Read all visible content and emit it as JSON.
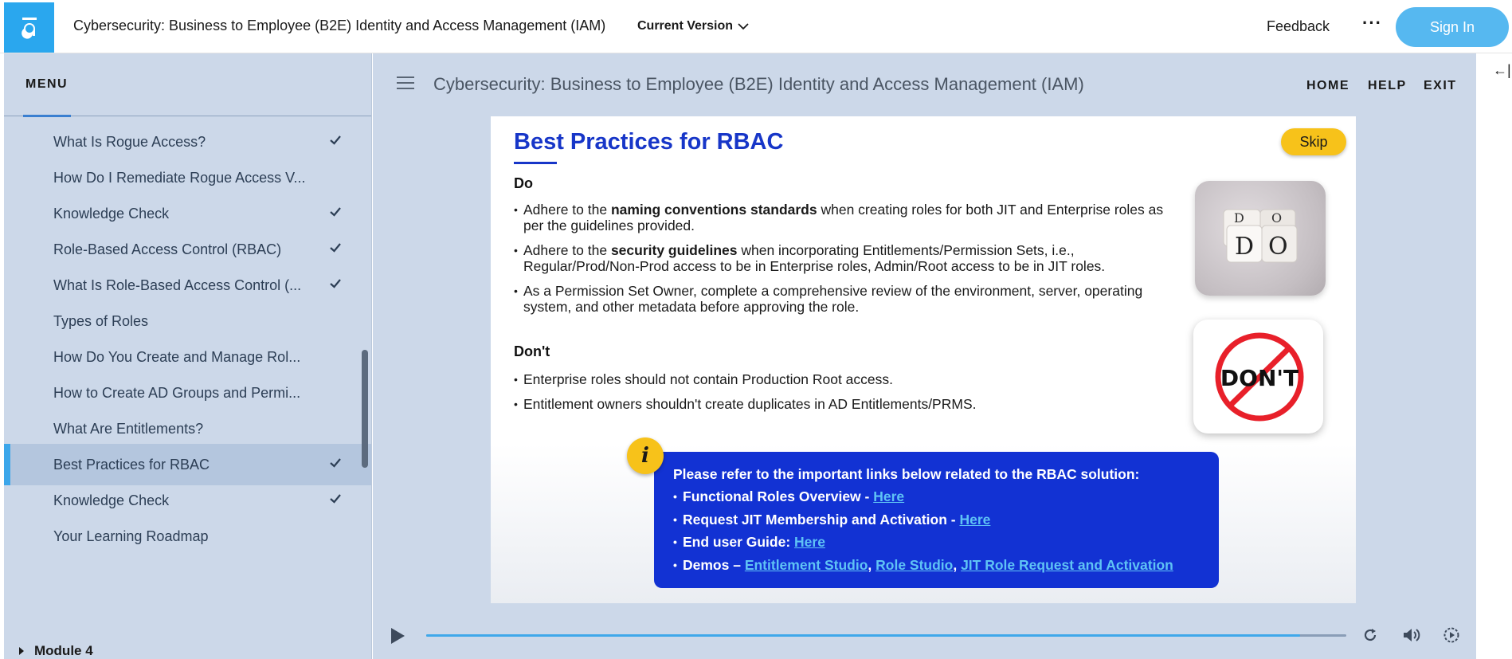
{
  "topbar": {
    "title": "Cybersecurity: Business to Employee (B2E) Identity and Access Management (IAM)",
    "version_label": "Current Version",
    "feedback_label": "Feedback",
    "more_label": "···",
    "signin_label": "Sign In"
  },
  "sidebar": {
    "menu_label": "MENU",
    "items": [
      {
        "label": "What Is Rogue Access?",
        "checked": true
      },
      {
        "label": "How Do I Remediate Rogue Access V...",
        "checked": false
      },
      {
        "label": "Knowledge Check",
        "checked": true
      },
      {
        "label": "Role-Based Access Control (RBAC)",
        "checked": true
      },
      {
        "label": "What Is Role-Based Access Control (...",
        "checked": true
      },
      {
        "label": "Types of Roles",
        "checked": false
      },
      {
        "label": "How Do You Create and Manage Rol...",
        "checked": false
      },
      {
        "label": "How to Create AD Groups and Permi...",
        "checked": false
      },
      {
        "label": "What Are Entitlements?",
        "checked": false
      },
      {
        "label": "Best Practices for RBAC",
        "checked": true,
        "active": true
      },
      {
        "label": "Knowledge Check",
        "checked": true
      },
      {
        "label": "Your Learning Roadmap",
        "checked": false
      }
    ],
    "module_label": "Module 4"
  },
  "main": {
    "course_title": "Cybersecurity: Business to Employee (B2E) Identity and Access Management (IAM)",
    "nav": {
      "home": "HOME",
      "help": "HELP",
      "exit": "EXIT"
    },
    "collapse_label": "←|"
  },
  "slide": {
    "title": "Best Practices for RBAC",
    "skip_label": "Skip",
    "do_heading": "Do",
    "do_items": [
      {
        "pre": "Adhere to the ",
        "bold": "naming conventions standards",
        "post": " when creating roles for both JIT and Enterprise roles as per the guidelines provided."
      },
      {
        "pre": "Adhere to the ",
        "bold": "security guidelines",
        "post": " when incorporating Entitlements/Permission Sets, i.e., Regular/Prod/Non-Prod access to be in Enterprise roles, Admin/Root access to be in JIT roles."
      },
      {
        "pre": "As a Permission Set Owner, complete a comprehensive review of the environment, server, operating system, and other metadata before approving the role.",
        "bold": "",
        "post": ""
      }
    ],
    "dont_heading": "Don't",
    "dont_items": [
      "Enterprise roles should not contain Production Root access.",
      "Entitlement owners shouldn't create duplicates in AD Entitlements/PRMS."
    ],
    "do_image_text": [
      "D",
      "O",
      "D",
      "O"
    ],
    "dont_image_text": "DON'T",
    "info": {
      "icon_text": "i",
      "intro": "Please refer to the important links below related to the RBAC solution:",
      "functional_roles": "Functional Roles Overview - ",
      "jit_request": "Request JIT Membership and Activation - ",
      "end_user": "End user Guide: ",
      "here": "Here",
      "demos": "Demos – ",
      "entitlement_studio": "Entitlement Studio",
      "role_studio": "Role Studio",
      "jit_role_request": "JIT Role Request and Activation",
      "comma": ", "
    }
  },
  "player": {
    "progress": 0.95
  },
  "colors": {
    "brand": "#2aa7ee",
    "sidebar_bg": "#ccd8e9",
    "slide_title": "#1736c8",
    "info_box": "#1232d3",
    "skip": "#f7c21a",
    "link": "#5fc3f5"
  }
}
